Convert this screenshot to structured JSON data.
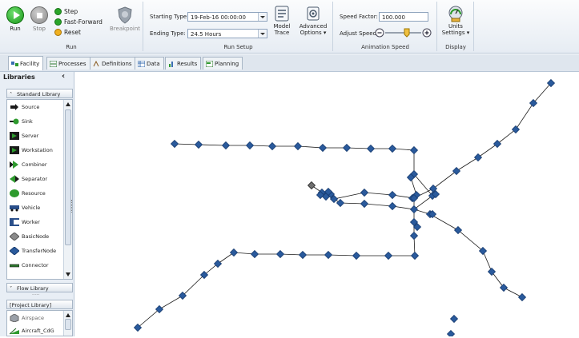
{
  "ribbon": {
    "run": {
      "run_label": "Run",
      "stop_label": "Stop",
      "step_label": "Step",
      "fast_forward_label": "Fast-Forward",
      "reset_label": "Reset",
      "breakpoint_label": "Breakpoint",
      "group_label": "Run"
    },
    "run_setup": {
      "starting_type_label": "Starting Type:",
      "starting_type_value": "19-Feb-16 00:00:00",
      "ending_type_label": "Ending Type:",
      "ending_type_value": "24.5 Hours",
      "model_trace_label": "Model Trace",
      "advanced_options_label": "Advanced Options",
      "group_label": "Run Setup"
    },
    "animation_speed": {
      "speed_factor_label": "Speed Factor:",
      "speed_factor_value": "100.000",
      "adjust_speed_label": "Adjust Speed:",
      "group_label": "Animation Speed"
    },
    "display": {
      "units_settings_label": "Units Settings",
      "group_label": "Display"
    }
  },
  "tabs": [
    {
      "label": "Facility",
      "active": true
    },
    {
      "label": "Processes",
      "active": false
    },
    {
      "label": "Definitions",
      "active": false
    },
    {
      "label": "Data",
      "active": false
    },
    {
      "label": "Results",
      "active": false
    },
    {
      "label": "Planning",
      "active": false
    }
  ],
  "libraries": {
    "title": "Libraries",
    "collapse_glyph": "‹",
    "standard_library": {
      "header": "Standard Library",
      "items": [
        "Source",
        "Sink",
        "Server",
        "Workstation",
        "Combiner",
        "Separator",
        "Resource",
        "Vehicle",
        "Worker",
        "BasicNode",
        "TransferNode",
        "Connector"
      ]
    },
    "flow_library": {
      "header": "Flow Library"
    },
    "project_library": {
      "header": "[Project Library]",
      "items": [
        "Airspace",
        "Aircraft_CdG"
      ]
    }
  },
  "colors": {
    "node": "#2a5a9c",
    "node_border": "#163a6e",
    "link": "#1a1a1a",
    "ribbon_accent": "#2e9a2e"
  }
}
